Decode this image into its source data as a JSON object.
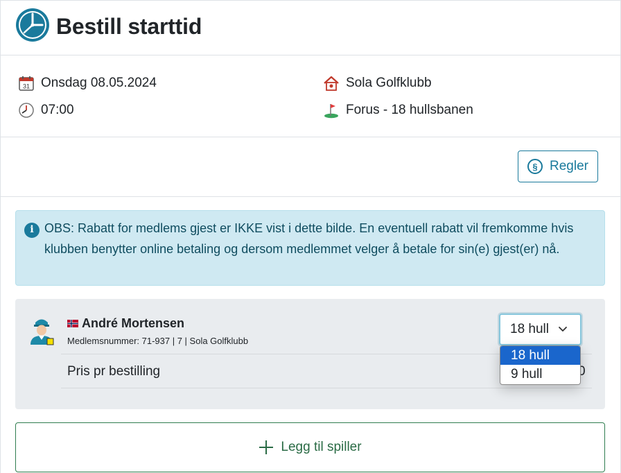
{
  "header": {
    "title": "Bestill starttid",
    "icon": "clock-icon"
  },
  "info": {
    "date": "Onsdag 08.05.2024",
    "time": "07:00",
    "club": "Sola Golfklubb",
    "course": "Forus - 18 hullsbanen",
    "calendar_day": "31"
  },
  "rules": {
    "button_label": "Regler",
    "icon_glyph": "§"
  },
  "alert": {
    "icon_glyph": "i",
    "text": "OBS: Rabatt for medlems gjest er IKKE vist i dette bilde. En eventuell rabatt vil fremkomme hvis klubben benytter online betaling og dersom medlemmet velger å betale for sin(e) gjest(er) nå."
  },
  "player": {
    "name": "André Mortensen",
    "meta": "Medlemsnummer: 71-937 | 7 | Sola Golfklubb",
    "price_label": "Pris pr bestilling",
    "price_value_visible": "0",
    "holes_selected": "18 hull",
    "holes_options": [
      "18 hull",
      "9 hull"
    ]
  },
  "add_player": {
    "label": "Legg til spiller"
  },
  "colors": {
    "accent": "#1a7a9c",
    "alert_bg": "#cfe9f2",
    "card_bg": "#e9ecef",
    "add_green": "#2f7d4f",
    "dropdown_selected": "#1a66cc"
  }
}
